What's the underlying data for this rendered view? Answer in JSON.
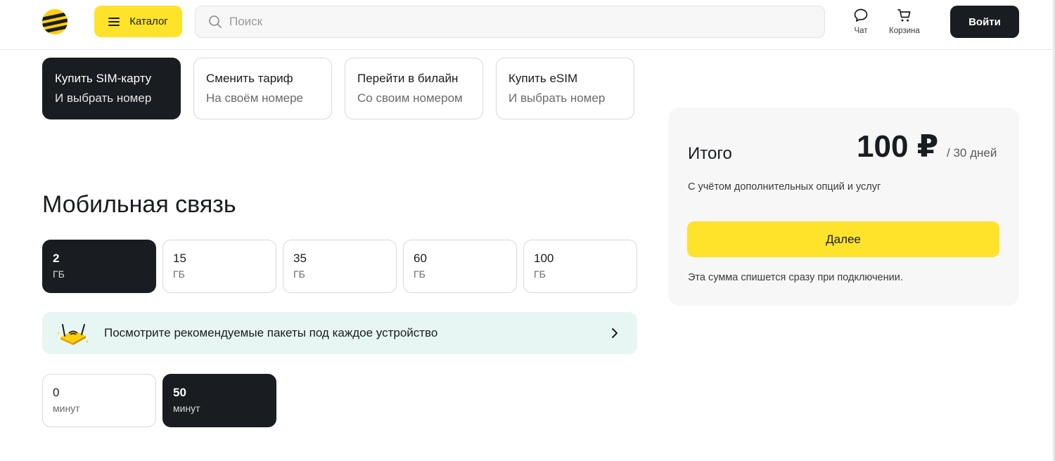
{
  "header": {
    "catalog_label": "Каталог",
    "search_placeholder": "Поиск",
    "chat_label": "Чат",
    "cart_label": "Корзина",
    "login_label": "Войти"
  },
  "options": [
    {
      "title": "Купить SIM-карту",
      "subtitle": "И выбрать номер",
      "active": true
    },
    {
      "title": "Сменить тариф",
      "subtitle": "На своём номере",
      "active": false
    },
    {
      "title": "Перейти в билайн",
      "subtitle": "Со своим номером",
      "active": false
    },
    {
      "title": "Купить eSIM",
      "subtitle": "И выбрать номер",
      "active": false
    }
  ],
  "section_title": "Мобильная связь",
  "data_packages": [
    {
      "value": "2",
      "unit": "ГБ",
      "active": true
    },
    {
      "value": "15",
      "unit": "ГБ",
      "active": false
    },
    {
      "value": "35",
      "unit": "ГБ",
      "active": false
    },
    {
      "value": "60",
      "unit": "ГБ",
      "active": false
    },
    {
      "value": "100",
      "unit": "ГБ",
      "active": false
    }
  ],
  "banner": {
    "text": "Посмотрите рекомендуемые пакеты под каждое устройство"
  },
  "minutes_packages": [
    {
      "value": "0",
      "unit": "минут",
      "active": false
    },
    {
      "value": "50",
      "unit": "минут",
      "active": true
    }
  ],
  "summary": {
    "total_label": "Итого",
    "price": "100 ₽",
    "period": "/ 30 дней",
    "note": "С учётом дополнительных опций и услуг",
    "next_label": "Далее",
    "charge_note": "Эта сумма спишется сразу при подключении."
  },
  "colors": {
    "brand_yellow": "#ffe32a",
    "dark": "#191c20",
    "banner_bg": "#e8f6f3",
    "panel_bg": "#f7f7f7"
  }
}
